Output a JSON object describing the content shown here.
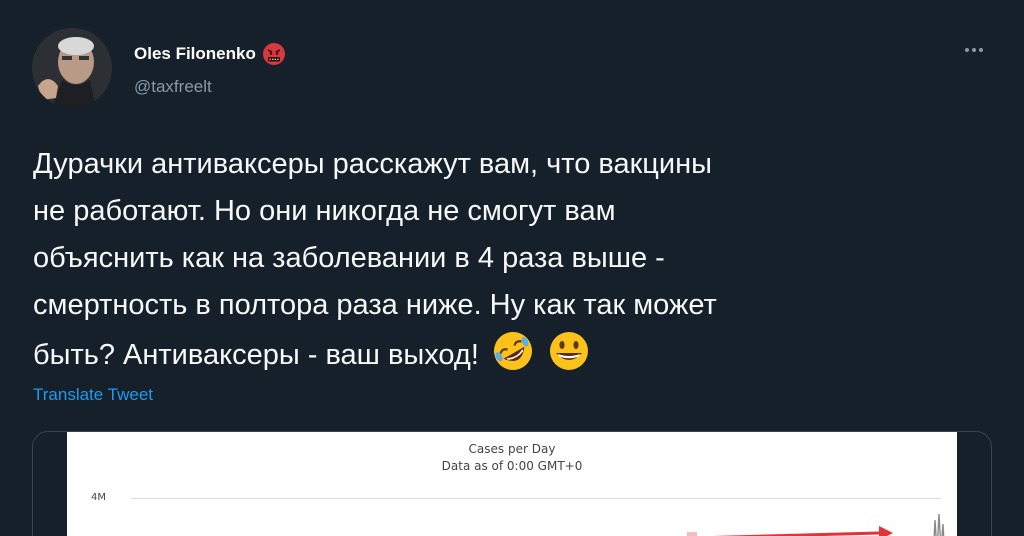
{
  "author": {
    "name": "Oles Filonenko",
    "handle": "@taxfreelt",
    "badge_icon": "angry-face-with-symbols-icon"
  },
  "tweet": {
    "lines": [
      "Дурачки антиваксеры расскажут вам, что вакцины",
      "не работают. Но они никогда не смогут вам",
      "объяснить как на заболевании в 4 раза выше -",
      "смертность в полтора раза ниже. Ну как так может",
      "быть? Антиваксеры - ваш выход!"
    ],
    "emojis": [
      "rolling-on-floor-laughing-icon",
      "grinning-face-icon"
    ],
    "translate_label": "Translate Tweet"
  },
  "media": {
    "chart_title": "Cases per Day",
    "chart_subtitle": "Data as of 0:00 GMT+0",
    "y_tick_top": "4M"
  },
  "colors": {
    "background": "#15202b",
    "link": "#1d9bf0",
    "secondary_text": "#8b98a5",
    "arrow_red": "#e0333a"
  }
}
